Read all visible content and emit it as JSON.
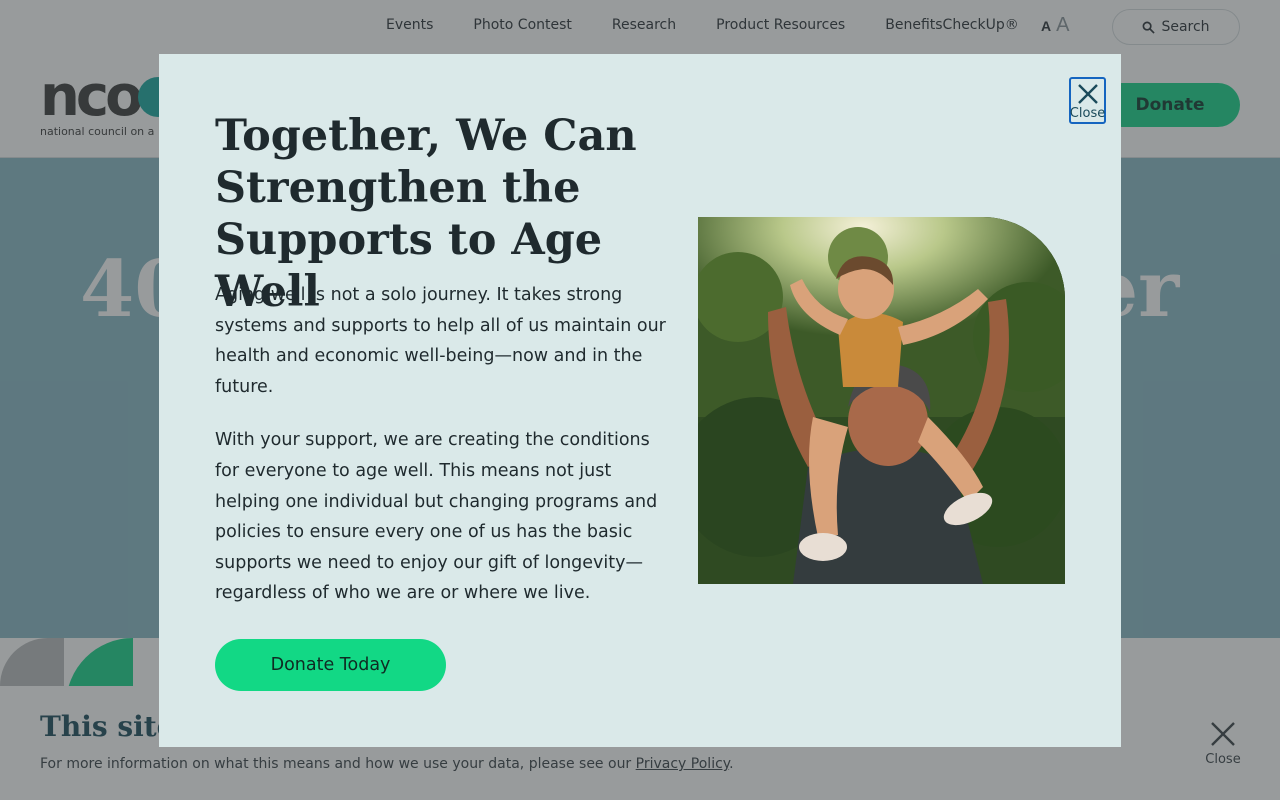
{
  "top_nav": {
    "links": [
      "Events",
      "Photo Contest",
      "Research",
      "Product Resources",
      "BenefitsCheckUp®"
    ],
    "font_toggle": {
      "small": "A",
      "large": "A"
    },
    "search_label": "Search"
  },
  "header": {
    "logo_text": "nco",
    "logo_tagline": "national council on a",
    "donate_label": "Donate"
  },
  "hero": {
    "title_left": "40",
    "title_right": "er"
  },
  "cookie_banner": {
    "heading": "This site",
    "text_before_link": "For more information on what this means and how we use your data, please see our ",
    "link_text": "Privacy Policy",
    "text_after_link": ".",
    "close_label": "Close"
  },
  "modal": {
    "title": "Together, We Can Strengthen the Supports to Age Well",
    "paragraphs": [
      "Aging well is not a solo journey. It takes strong systems and supports to help all of us maintain our health and economic well-being—now and in the future.",
      "With your support, we are creating the conditions for everyone to age well. This means not just helping one individual but changing programs and policies to ensure every one of us has the basic supports we need to enjoy our gift of longevity—regardless of who we are or where we live."
    ],
    "cta_label": "Donate Today",
    "close_label": "Close"
  },
  "colors": {
    "brand_green": "#12d885",
    "hero_teal": "#8bbac7",
    "modal_bg": "#dae9e9",
    "heading_teal": "#1c4d5c",
    "focus_blue": "#1565c0"
  }
}
